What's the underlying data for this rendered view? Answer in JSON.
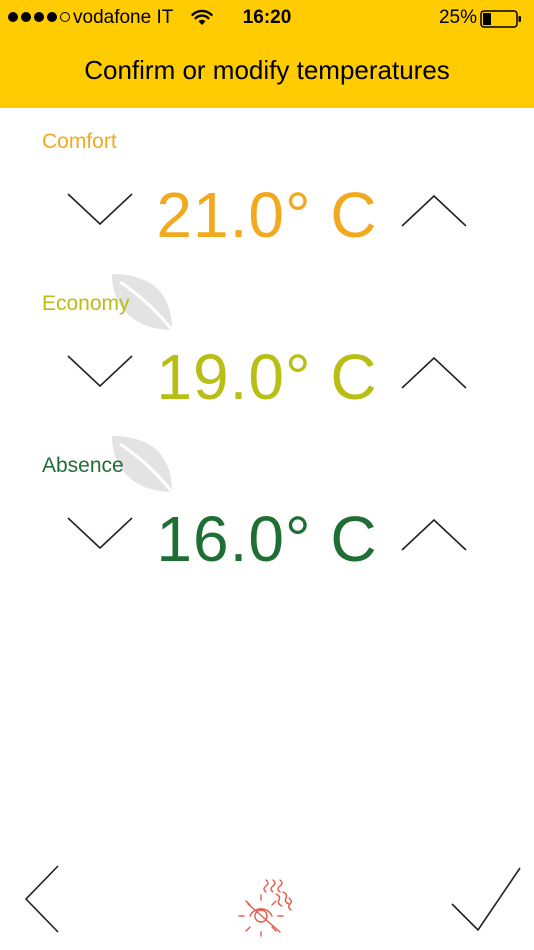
{
  "status_bar": {
    "carrier": "vodafone IT",
    "time": "16:20",
    "battery_percent": "25%",
    "battery_level": 0.25,
    "signal_bars": 4
  },
  "header": {
    "title": "Confirm or modify temperatures",
    "background_color": "#FECC00"
  },
  "sections": [
    {
      "label": "Comfort",
      "value": "21.0° C",
      "color": "#F1A91D",
      "leaf_icon": false
    },
    {
      "label": "Economy",
      "value": "19.0° C",
      "color": "#B8BE14",
      "leaf_icon": true
    },
    {
      "label": "Absence",
      "value": "16.0° C",
      "color": "#1F6E34",
      "leaf_icon": true
    }
  ],
  "icons": {
    "decrease": "chevron-down-icon",
    "increase": "chevron-up-icon",
    "leaf": "leaf-icon",
    "back": "chevron-left-icon",
    "mode": "sun-heat-icon",
    "confirm": "checkmark-icon"
  },
  "colors": {
    "mode_icon": "#E8594A",
    "chevron_stroke": "#222222",
    "leaf_fill": "#E3E3E3"
  }
}
